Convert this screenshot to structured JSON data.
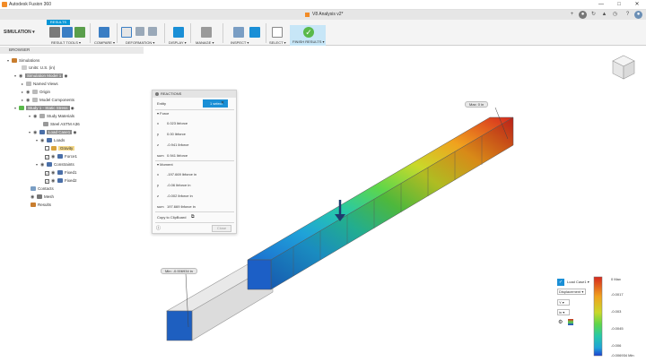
{
  "app": {
    "title": "Autodesk Fusion 360",
    "document_tab": "V8 Analysis v2*"
  },
  "toolbar": {
    "workspace": "SIMULATION",
    "active_tab": "RESULTS",
    "groups": [
      "RESULT TOOLS",
      "COMPARE",
      "DEFORMATION",
      "DISPLAY",
      "MANAGE",
      "INSPECT",
      "SELECT",
      "FINISH RESULTS"
    ]
  },
  "browser": {
    "header": "BROWSER",
    "items": [
      {
        "label": "Simulations"
      },
      {
        "label": "Units: U.S. (in)"
      },
      {
        "label": "Simulation Model 1"
      },
      {
        "label": "Named Views"
      },
      {
        "label": "Origin"
      },
      {
        "label": "Model Components"
      },
      {
        "label": "Study 1 - Static Stress"
      },
      {
        "label": "Study Materials"
      },
      {
        "label": "Steel ASTM A36"
      },
      {
        "label": "Load Case1"
      },
      {
        "label": "Loads"
      },
      {
        "label": "Gravity"
      },
      {
        "label": "Force1"
      },
      {
        "label": "Constraints"
      },
      {
        "label": "Fixed1"
      },
      {
        "label": "Fixed2"
      },
      {
        "label": "Contacts"
      },
      {
        "label": "Mesh"
      },
      {
        "label": "Results"
      }
    ]
  },
  "reactions": {
    "title": "REACTIONS",
    "entity_label": "Entity",
    "select_button": "1 select",
    "force_header": "Force",
    "force_rows": [
      {
        "axis": "x",
        "value": "0.023 lbforce"
      },
      {
        "axis": "y",
        "value": "0.00 lbforce"
      },
      {
        "axis": "z",
        "value": "-0.941 lbforce"
      },
      {
        "axis": "sum",
        "value": "0.941 lbforce"
      }
    ],
    "moment_header": "Moment",
    "moment_rows": [
      {
        "axis": "x",
        "value": "-197.669 lbforce in"
      },
      {
        "axis": "y",
        "value": "-0.06 lbforce in"
      },
      {
        "axis": "z",
        "value": "-0.002 lbforce in"
      },
      {
        "axis": "sum",
        "value": "197.669 lbforce in"
      }
    ],
    "copy_label": "Copy to ClipBoard",
    "close_label": "Close"
  },
  "viewport": {
    "max_flag": "Max: 0 in",
    "min_flag": "Min: -0.006934 in"
  },
  "legend": {
    "load_case": "Load Case1",
    "result_type": "Displacement",
    "component": "Y",
    "unit": "in",
    "ticks": [
      "0 Max",
      "-0.0017",
      "-0.003",
      "-0.0045",
      "-0.006",
      "-0.006934 Min"
    ]
  },
  "colors": {
    "accent": "#0696d7",
    "finish": "#59b94a"
  }
}
